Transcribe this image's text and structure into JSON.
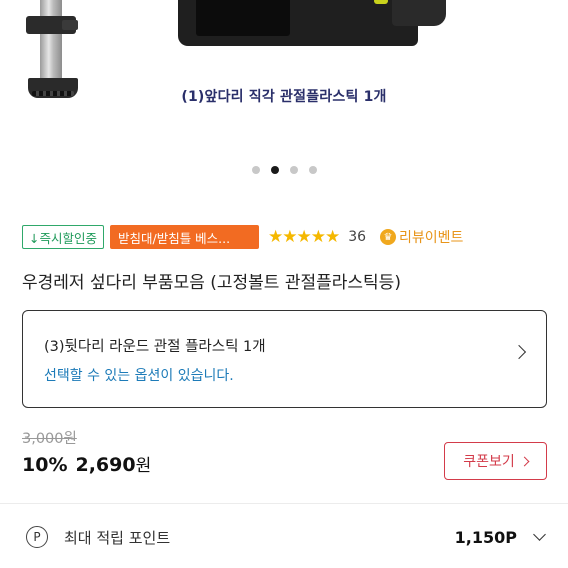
{
  "hero": {
    "caption": "(1)앞다리 직각 관절플라스틱 1개",
    "dots_count": 4,
    "active_dot": 1
  },
  "badges": {
    "instant_discount": "↓즉시할인중",
    "category": "받침대/받침틀 베스...",
    "stars": "★★★★★",
    "review_count": "36",
    "event_label": "리뷰이벤트"
  },
  "product": {
    "title": "우경레저 섶다리 부품모음 (고정볼트 관절플라스틱등)"
  },
  "option": {
    "selected": "(3)뒷다리 라운드 관절 플라스틱 1개",
    "hint": "선택할 수 있는 옵션이 있습니다."
  },
  "price": {
    "original": "3,000원",
    "discount": "10%",
    "sale": "2,690",
    "currency": "원",
    "coupon_label": "쿠폰보기"
  },
  "points": {
    "icon_letter": "P",
    "label": "최대 적립 포인트",
    "value": "1,150P"
  },
  "colors": {
    "green": "#1f9a5a",
    "orange": "#f26b22",
    "star": "#f5b800",
    "link_blue": "#1d7bb8",
    "coupon_red": "#d33b4a",
    "caption_navy": "#2a2f6a"
  }
}
